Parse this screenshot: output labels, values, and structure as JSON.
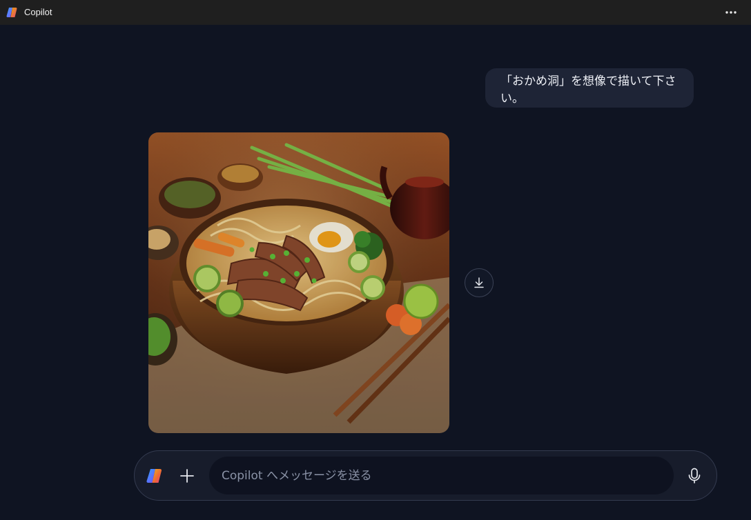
{
  "app": {
    "title": "Copilot",
    "logo_icon": "copilot-logo-icon",
    "more_icon": "more-horizontal-icon"
  },
  "conversation": {
    "user_message": "「おかめ洞」を想像で描いて下さい。",
    "generated_image": {
      "subject": "ramen-bowl-image",
      "download_icon": "download-icon"
    }
  },
  "composer": {
    "placeholder": "Copilot へメッセージを送る",
    "value": "",
    "add_icon": "plus-icon",
    "mic_icon": "microphone-icon"
  },
  "colors": {
    "background": "#0f1422",
    "titlebar": "#1f1f1f",
    "bubble": "#1e2436",
    "composer": "#171c2b",
    "input": "#0e1220"
  }
}
